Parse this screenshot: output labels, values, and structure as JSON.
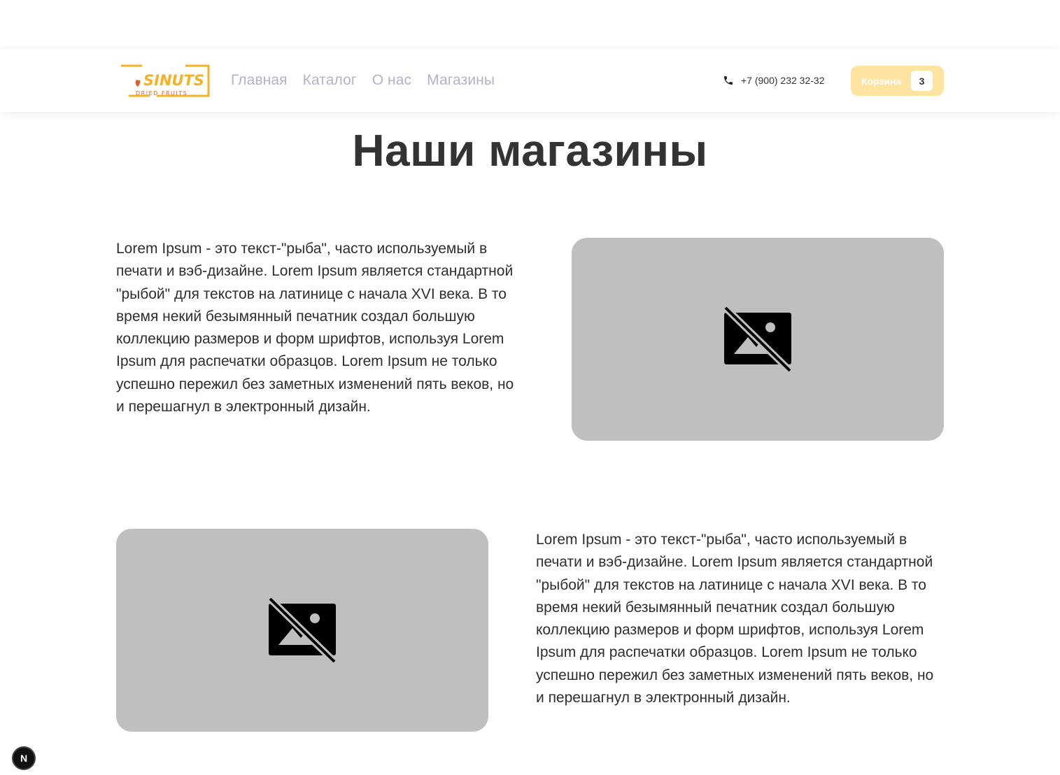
{
  "header": {
    "logo": {
      "brand": "SINUTS",
      "tagline": "DRIED FRUITS",
      "brand_color": "#f5b324",
      "accent_color": "#d9622b"
    },
    "nav": [
      {
        "label": "Главная"
      },
      {
        "label": "Каталог"
      },
      {
        "label": "О нас"
      },
      {
        "label": "Магазины"
      }
    ],
    "phone": {
      "icon": "phone-icon",
      "number": "+7 (900) 232 32-32"
    },
    "cart": {
      "label": "Корзина",
      "count": "3",
      "color": "#ffe3a1"
    }
  },
  "main": {
    "title": "Наши магазины",
    "shops": [
      {
        "text": "Lorem Ipsum - это текст-\"рыба\", часто используемый в печати и вэб-дизайне. Lorem Ipsum является стандартной \"рыбой\" для текстов на латинице с начала XVI века. В то время некий безымянный печатник создал большую коллекцию размеров и форм шрифтов, используя Lorem Ipsum для распечатки образцов. Lorem Ipsum не только успешно пережил без заметных изменений пять веков, но и перешагнул в электронный дизайн.",
        "image_icon": "image-not-supported-icon",
        "placeholder_color": "#bfbfbf"
      },
      {
        "text": "Lorem Ipsum - это текст-\"рыба\", часто используемый в печати и вэб-дизайне. Lorem Ipsum является стандартной \"рыбой\" для текстов на латинице с начала XVI века. В то время некий безымянный печатник создал большую коллекцию размеров и форм шрифтов, используя Lorem Ipsum для распечатки образцов. Lorem Ipsum не только успешно пережил без заметных изменений пять веков, но и перешагнул в электронный дизайн.",
        "image_icon": "image-not-supported-icon",
        "placeholder_color": "#bfbfbf"
      }
    ]
  },
  "badge": {
    "letter": "N"
  }
}
